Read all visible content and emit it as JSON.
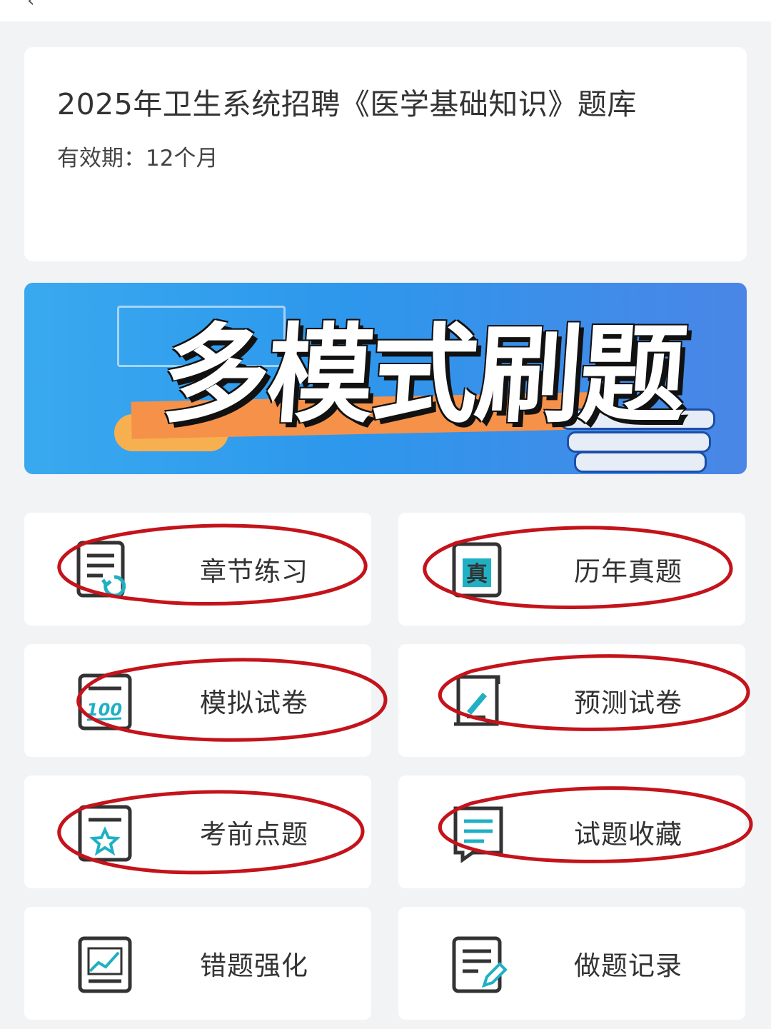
{
  "product": {
    "title": "2025年卫生系统招聘《医学基础知识》题库",
    "validity": "有效期：12个月"
  },
  "banner": {
    "headline": "多模式刷题"
  },
  "menu": [
    {
      "label": "章节练习",
      "icon": "chapter-practice-icon",
      "circled": true
    },
    {
      "label": "历年真题",
      "icon": "past-exams-icon",
      "circled": true
    },
    {
      "label": "模拟试卷",
      "icon": "mock-paper-icon",
      "circled": true
    },
    {
      "label": "预测试卷",
      "icon": "forecast-paper-icon",
      "circled": true
    },
    {
      "label": "考前点题",
      "icon": "pre-exam-tips-icon",
      "circled": true
    },
    {
      "label": "试题收藏",
      "icon": "favorites-icon",
      "circled": true
    },
    {
      "label": "错题强化",
      "icon": "wrong-questions-icon",
      "circled": false
    },
    {
      "label": "做题记录",
      "icon": "practice-record-icon",
      "circled": false
    }
  ],
  "colors": {
    "accent": "#1fb0c4",
    "icon_stroke": "#333333",
    "annotation": "#c4131b",
    "banner_blue": "#2d97ec",
    "banner_orange": "#f6914a"
  }
}
